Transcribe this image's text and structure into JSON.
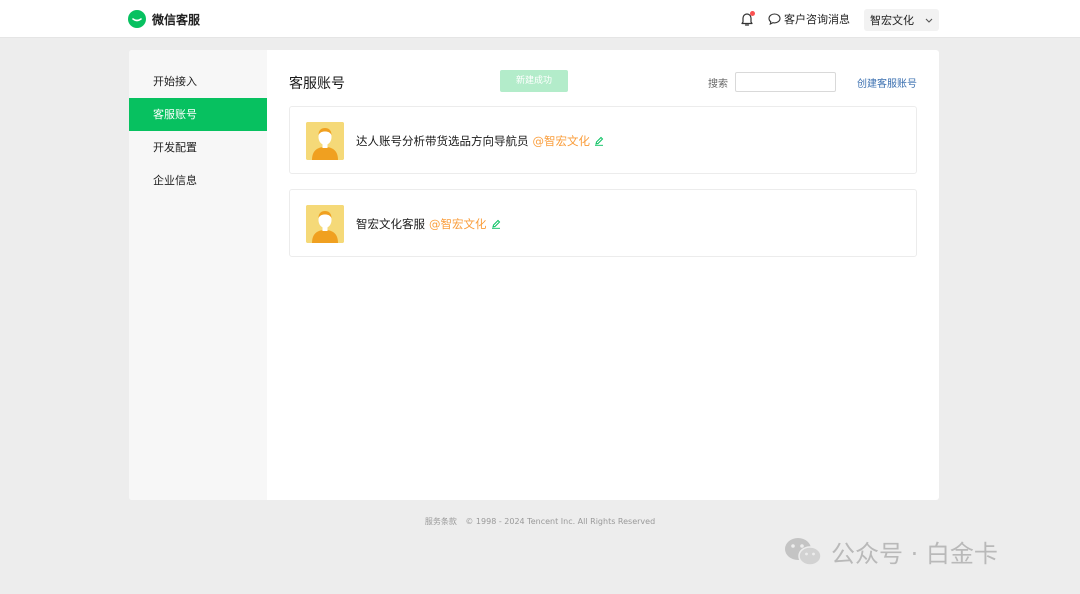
{
  "header": {
    "brand_title": "微信客服",
    "customer_messages": "客户咨询消息",
    "org_name": "智宏文化"
  },
  "sidebar": {
    "items": [
      {
        "label": "开始接入"
      },
      {
        "label": "客服账号"
      },
      {
        "label": "开发配置"
      },
      {
        "label": "企业信息"
      }
    ]
  },
  "main": {
    "title": "客服账号",
    "toast": "新建成功",
    "search_label": "搜索",
    "search_value": "",
    "create_link": "创建客服账号",
    "accounts": [
      {
        "name": "达人账号分析带货选品方向导航员",
        "corp": "@智宏文化"
      },
      {
        "name": "智宏文化客服",
        "corp": "@智宏文化"
      }
    ]
  },
  "footer": {
    "terms": "服务条款",
    "copyright": "© 1998 - 2024 Tencent Inc. All Rights Reserved"
  },
  "watermark": {
    "text": "公众号 · 白金卡"
  },
  "colors": {
    "brand_green": "#07c160",
    "corp_orange": "#fa9d3b",
    "link_blue": "#3a6fb0",
    "badge_red": "#fa5151"
  },
  "icons": {
    "logo": "wechat-service-logo-icon",
    "bell": "bell-icon",
    "chat": "chat-bubble-icon",
    "dropdown": "chevron-down-icon",
    "edit": "pencil-edit-icon"
  }
}
